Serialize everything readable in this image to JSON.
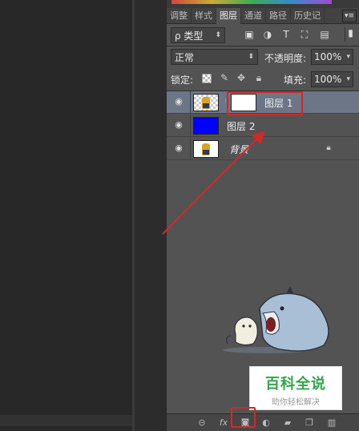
{
  "tabs": [
    "调整",
    "样式",
    "图层",
    "通道",
    "路径",
    "历史记"
  ],
  "tab_menu_icon": "panel-menu-icon",
  "filter": {
    "kind_label": "ρ 类型",
    "icons": [
      "image-filter-icon",
      "adjustment-filter-icon",
      "type-filter-icon",
      "shape-filter-icon",
      "smart-object-filter-icon",
      "filter-toggle-icon"
    ]
  },
  "blend": {
    "mode": "正常",
    "opacity_label": "不透明度:",
    "opacity_value": "100%"
  },
  "lock": {
    "label": "锁定:",
    "icons": [
      "lock-transparent-icon",
      "lock-image-icon",
      "lock-position-icon",
      "lock-all-icon"
    ],
    "fill_label": "填充:",
    "fill_value": "100%"
  },
  "layers": [
    {
      "name": "图层 1",
      "visible": true,
      "selected": true,
      "has_mask": true
    },
    {
      "name": "图层 2",
      "visible": true,
      "selected": false,
      "has_mask": false
    },
    {
      "name": "背景",
      "visible": true,
      "selected": false,
      "has_mask": false,
      "locked": true
    }
  ],
  "footer_icons": [
    "link-layers-icon",
    "layer-style-icon",
    "add-mask-icon",
    "adjustment-layer-icon",
    "group-folder-icon",
    "new-layer-icon",
    "trash-icon"
  ],
  "watermark": {
    "title": "百科全说",
    "subtitle": "助你轻松解决"
  },
  "colors": {
    "panel": "#535353",
    "selected_row": "#6c7686",
    "highlight": "#d3282a",
    "blue_layer": "#0000ff"
  }
}
